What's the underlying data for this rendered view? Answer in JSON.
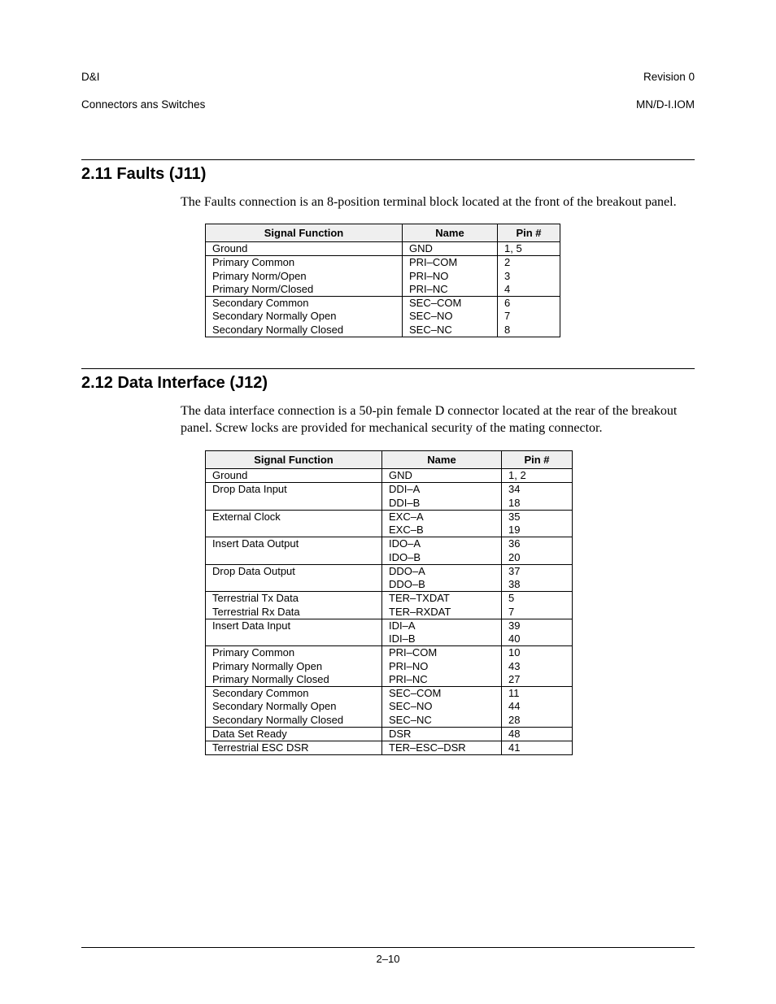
{
  "header": {
    "left_line1": "D&I",
    "left_line2": "Connectors ans Switches",
    "right_line1": "Revision 0",
    "right_line2": "MN/D-I.IOM"
  },
  "section_211": {
    "heading": "2.11  Faults (J11)",
    "paragraph": "The Faults connection is an 8-position terminal block located at the front of the breakout panel.",
    "table": {
      "headers": {
        "func": "Signal Function",
        "name": "Name",
        "pin": "Pin #"
      },
      "groups": [
        [
          {
            "func": "Ground",
            "name": "GND",
            "pin": "1, 5"
          }
        ],
        [
          {
            "func": "Primary Common",
            "name": "PRI–COM",
            "pin": "2"
          },
          {
            "func": "Primary Norm/Open",
            "name": "PRI–NO",
            "pin": "3"
          },
          {
            "func": "Primary Norm/Closed",
            "name": "PRI–NC",
            "pin": "4"
          }
        ],
        [
          {
            "func": "Secondary Common",
            "name": "SEC–COM",
            "pin": "6"
          },
          {
            "func": "Secondary Normally Open",
            "name": "SEC–NO",
            "pin": "7"
          },
          {
            "func": "Secondary Normally Closed",
            "name": "SEC–NC",
            "pin": "8"
          }
        ]
      ]
    }
  },
  "section_212": {
    "heading": "2.12  Data Interface (J12)",
    "paragraph": "The data interface connection is a 50-pin female D connector located at the rear of the breakout panel. Screw locks are provided for mechanical security of the mating connector.",
    "table": {
      "headers": {
        "func": "Signal Function",
        "name": "Name",
        "pin": "Pin #"
      },
      "groups": [
        [
          {
            "func": "Ground",
            "name": "GND",
            "pin": "1, 2"
          }
        ],
        [
          {
            "func": "Drop Data Input",
            "name": "DDI–A",
            "pin": "34"
          },
          {
            "func": "",
            "name": "DDI–B",
            "pin": "18"
          }
        ],
        [
          {
            "func": "External Clock",
            "name": "EXC–A",
            "pin": "35"
          },
          {
            "func": "",
            "name": "EXC–B",
            "pin": "19"
          }
        ],
        [
          {
            "func": "Insert Data Output",
            "name": "IDO–A",
            "pin": "36"
          },
          {
            "func": "",
            "name": "IDO–B",
            "pin": "20"
          }
        ],
        [
          {
            "func": "Drop Data Output",
            "name": "DDO–A",
            "pin": "37"
          },
          {
            "func": "",
            "name": "DDO–B",
            "pin": "38"
          }
        ],
        [
          {
            "func": "Terrestrial Tx Data",
            "name": "TER–TXDAT",
            "pin": "5"
          },
          {
            "func": "Terrestrial Rx Data",
            "name": "TER–RXDAT",
            "pin": "7"
          }
        ],
        [
          {
            "func": "Insert Data Input",
            "name": "IDI–A",
            "pin": "39"
          },
          {
            "func": "",
            "name": "IDI–B",
            "pin": "40"
          }
        ],
        [
          {
            "func": "Primary Common",
            "name": "PRI–COM",
            "pin": "10"
          },
          {
            "func": "Primary Normally Open",
            "name": "PRI–NO",
            "pin": "43"
          },
          {
            "func": "Primary Normally Closed",
            "name": "PRI–NC",
            "pin": "27"
          }
        ],
        [
          {
            "func": "Secondary Common",
            "name": "SEC–COM",
            "pin": "11"
          },
          {
            "func": "Secondary Normally Open",
            "name": "SEC–NO",
            "pin": "44"
          },
          {
            "func": "Secondary Normally Closed",
            "name": "SEC–NC",
            "pin": "28"
          }
        ],
        [
          {
            "func": "Data Set Ready",
            "name": "DSR",
            "pin": "48"
          }
        ],
        [
          {
            "func": "Terrestrial ESC DSR",
            "name": "TER–ESC–DSR",
            "pin": "41"
          }
        ]
      ]
    }
  },
  "footer": {
    "page_number": "2–10"
  }
}
